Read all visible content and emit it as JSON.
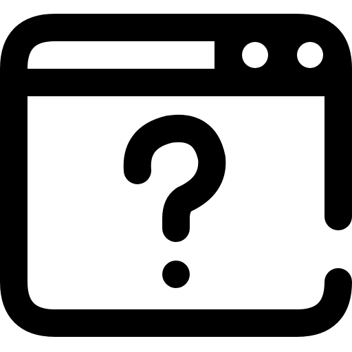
{
  "icon": {
    "name": "browser-window-question-icon",
    "stroke_color": "#000000",
    "fill_color": "#ffffff",
    "title_bar_dots": 2,
    "symbol": "question-mark"
  }
}
